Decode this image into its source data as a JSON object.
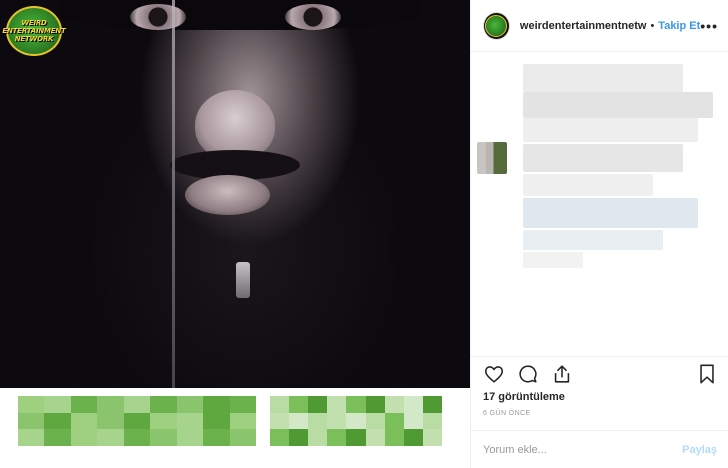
{
  "post": {
    "logo_lines": [
      "WEIRD",
      "ENTERTAINMENT",
      "NETWORK"
    ]
  },
  "header": {
    "username": "weirdentertainmentnetw",
    "separator": "•",
    "follow_label": "Takip Et",
    "more_label": "•••"
  },
  "stats": {
    "views": "17 görüntüleme",
    "date": "6 GÜN ÖNCE"
  },
  "comment": {
    "placeholder": "Yorum ekle...",
    "submit_label": "Paylaş"
  },
  "colors": {
    "accent": "#3897f0",
    "submit_disabled": "#b3dbff",
    "logo_green": "#2e7f24",
    "logo_gold": "#e7c32a"
  },
  "icons": [
    "heart-icon",
    "comment-icon",
    "share-icon",
    "bookmark-icon"
  ]
}
